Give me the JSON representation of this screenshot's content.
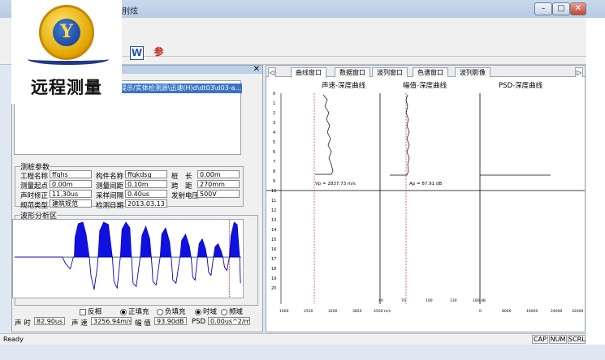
{
  "window": {
    "title": "刖炫",
    "min": "–",
    "max": "□",
    "close": "✕"
  },
  "logo": {
    "text": "远程测量"
  },
  "toolbar": {
    "word_icon": "W",
    "param_icon": "参"
  },
  "left": {
    "close": "✕",
    "list_item": "提示/实体检测源\\迅速(H)d\\dt03\\d03-a...",
    "params_title": "测桩参数",
    "params": {
      "project_name_label": "工程名称",
      "project_name": "ffqhs",
      "component_label": "构件名称",
      "component": "ffqkdsg",
      "pile_length_label": "桩　长",
      "pile_length": "0.00m",
      "start_point_label": "测量起点",
      "start_point": "0.00m",
      "step_label": "测量间距",
      "step": "0.10m",
      "spacing_label": "跨　距",
      "spacing": "270mm",
      "zero_label": "声时修正",
      "zero": "11.30us",
      "sample_label": "采样间隔",
      "sample": "0.40us",
      "voltage_label": "发射电压",
      "voltage": "500V",
      "norm_label": "规范类型",
      "norm": "建筑规范",
      "date_label": "检测日期",
      "date": "2013.03.13"
    },
    "wave_title": "波形分析区",
    "invert_label": "反相",
    "pos_fill_label": "正填充",
    "neg_fill_label": "负填充",
    "time_label": "时域",
    "freq_label": "频域",
    "sound_time_label": "声 时",
    "sound_time": "82.90us",
    "speed_label": "声 速",
    "speed": "3256.94m/s",
    "amp_label": "幅 值",
    "amp": "93.90dB",
    "psd_label": "PSD",
    "psd": "0.00us^2/m"
  },
  "right": {
    "tabs": [
      "曲线窗口",
      "数据窗口",
      "波列窗口",
      "色谱窗口",
      "波列影像"
    ],
    "nav_left": "◁",
    "nav_right": "▷",
    "col_titles": [
      "声速-深度曲线",
      "幅值-深度曲线",
      "PSD-深度曲线"
    ],
    "vp_label": "Vp = 2837.73 m/s",
    "ap_label": "Ap = 87.91 dB",
    "depth_ticks": [
      "0",
      "1",
      "2",
      "3",
      "4",
      "5",
      "6",
      "7",
      "8",
      "9",
      "10",
      "11",
      "12",
      "13",
      "14",
      "15",
      "16",
      "17",
      "18",
      "19",
      "20"
    ],
    "speed_axis": [
      "1900",
      "2550",
      "3200",
      "3850",
      "4500 m/s"
    ],
    "amp_axis": [
      "40",
      "70",
      "100",
      "130",
      "160 dB"
    ],
    "psd_axis": [
      "0",
      "8000",
      "16000",
      "24000",
      "32000"
    ]
  },
  "status": {
    "ready": "Ready",
    "cap": "CAP",
    "num": "NUM",
    "scrl": "SCRL"
  }
}
